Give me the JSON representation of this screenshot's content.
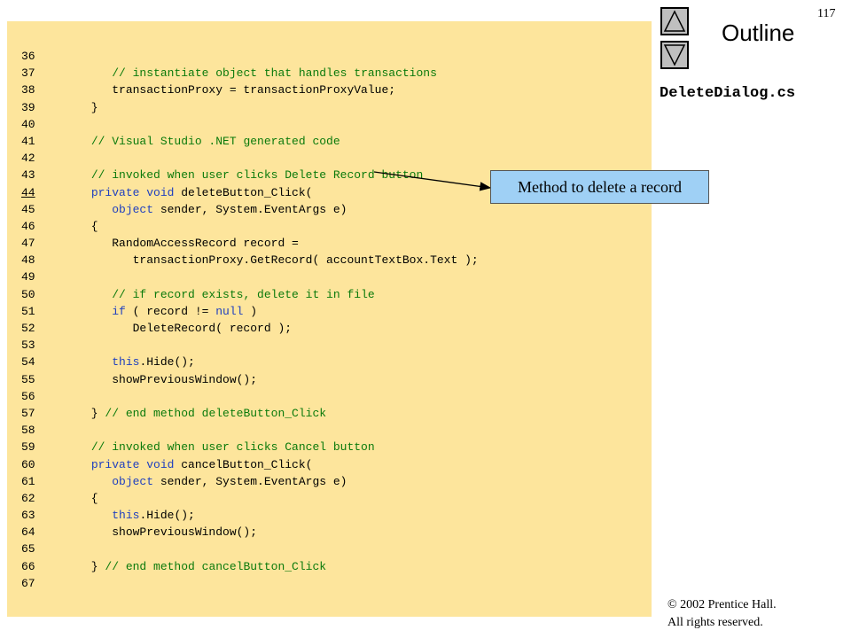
{
  "page_number": "117",
  "sidebar": {
    "outline_label": "Outline",
    "filename": "DeleteDialog.cs",
    "up_icon": "triangle-up-icon",
    "down_icon": "triangle-down-icon"
  },
  "callout": {
    "text": "Method to delete a record"
  },
  "copyright": {
    "line1": "© 2002 Prentice Hall.",
    "line2": "All rights reserved."
  },
  "colors": {
    "panel": "#fde59c",
    "keyword": "#1f3fbf",
    "comment": "#0b7a0b",
    "callout": "#9fd0f5",
    "button": "#bfbfbf"
  },
  "code": {
    "highlighted_line": "44",
    "lines": [
      {
        "n": "36",
        "tokens": []
      },
      {
        "n": "37",
        "tokens": [
          {
            "t": "         "
          },
          {
            "t": "// instantiate object that handles transactions",
            "c": "cm"
          }
        ]
      },
      {
        "n": "38",
        "tokens": [
          {
            "t": "         transactionProxy = transactionProxyValue;"
          }
        ]
      },
      {
        "n": "39",
        "tokens": [
          {
            "t": "      }"
          }
        ]
      },
      {
        "n": "40",
        "tokens": []
      },
      {
        "n": "41",
        "tokens": [
          {
            "t": "      "
          },
          {
            "t": "// Visual Studio .NET generated code",
            "c": "cm"
          }
        ]
      },
      {
        "n": "42",
        "tokens": []
      },
      {
        "n": "43",
        "tokens": [
          {
            "t": "      "
          },
          {
            "t": "// invoked when user clicks Delete Record button",
            "c": "cm"
          }
        ]
      },
      {
        "n": "44",
        "tokens": [
          {
            "t": "      "
          },
          {
            "t": "private void",
            "c": "kw"
          },
          {
            "t": " deleteButton_Click("
          }
        ]
      },
      {
        "n": "45",
        "tokens": [
          {
            "t": "         "
          },
          {
            "t": "object",
            "c": "kw"
          },
          {
            "t": " sender, System.EventArgs e)"
          }
        ]
      },
      {
        "n": "46",
        "tokens": [
          {
            "t": "      {"
          }
        ]
      },
      {
        "n": "47",
        "tokens": [
          {
            "t": "         RandomAccessRecord record ="
          }
        ]
      },
      {
        "n": "48",
        "tokens": [
          {
            "t": "            transactionProxy.GetRecord( accountTextBox.Text );"
          }
        ]
      },
      {
        "n": "49",
        "tokens": []
      },
      {
        "n": "50",
        "tokens": [
          {
            "t": "         "
          },
          {
            "t": "// if record exists, delete it in file",
            "c": "cm"
          }
        ]
      },
      {
        "n": "51",
        "tokens": [
          {
            "t": "         "
          },
          {
            "t": "if",
            "c": "kw"
          },
          {
            "t": " ( record != "
          },
          {
            "t": "null",
            "c": "kw"
          },
          {
            "t": " )"
          }
        ]
      },
      {
        "n": "52",
        "tokens": [
          {
            "t": "            DeleteRecord( record );"
          }
        ]
      },
      {
        "n": "53",
        "tokens": []
      },
      {
        "n": "54",
        "tokens": [
          {
            "t": "         "
          },
          {
            "t": "this",
            "c": "kw"
          },
          {
            "t": ".Hide();"
          }
        ]
      },
      {
        "n": "55",
        "tokens": [
          {
            "t": "         showPreviousWindow();"
          }
        ]
      },
      {
        "n": "56",
        "tokens": []
      },
      {
        "n": "57",
        "tokens": [
          {
            "t": "      } "
          },
          {
            "t": "// end method deleteButton_Click",
            "c": "cm"
          }
        ]
      },
      {
        "n": "58",
        "tokens": []
      },
      {
        "n": "59",
        "tokens": [
          {
            "t": "      "
          },
          {
            "t": "// invoked when user clicks Cancel button",
            "c": "cm"
          }
        ]
      },
      {
        "n": "60",
        "tokens": [
          {
            "t": "      "
          },
          {
            "t": "private void",
            "c": "kw"
          },
          {
            "t": " cancelButton_Click("
          }
        ]
      },
      {
        "n": "61",
        "tokens": [
          {
            "t": "         "
          },
          {
            "t": "object",
            "c": "kw"
          },
          {
            "t": " sender, System.EventArgs e)"
          }
        ]
      },
      {
        "n": "62",
        "tokens": [
          {
            "t": "      {"
          }
        ]
      },
      {
        "n": "63",
        "tokens": [
          {
            "t": "         "
          },
          {
            "t": "this",
            "c": "kw"
          },
          {
            "t": ".Hide();"
          }
        ]
      },
      {
        "n": "64",
        "tokens": [
          {
            "t": "         showPreviousWindow();"
          }
        ]
      },
      {
        "n": "65",
        "tokens": []
      },
      {
        "n": "66",
        "tokens": [
          {
            "t": "      } "
          },
          {
            "t": "// end method cancelButton_Click",
            "c": "cm"
          }
        ]
      },
      {
        "n": "67",
        "tokens": []
      }
    ]
  }
}
